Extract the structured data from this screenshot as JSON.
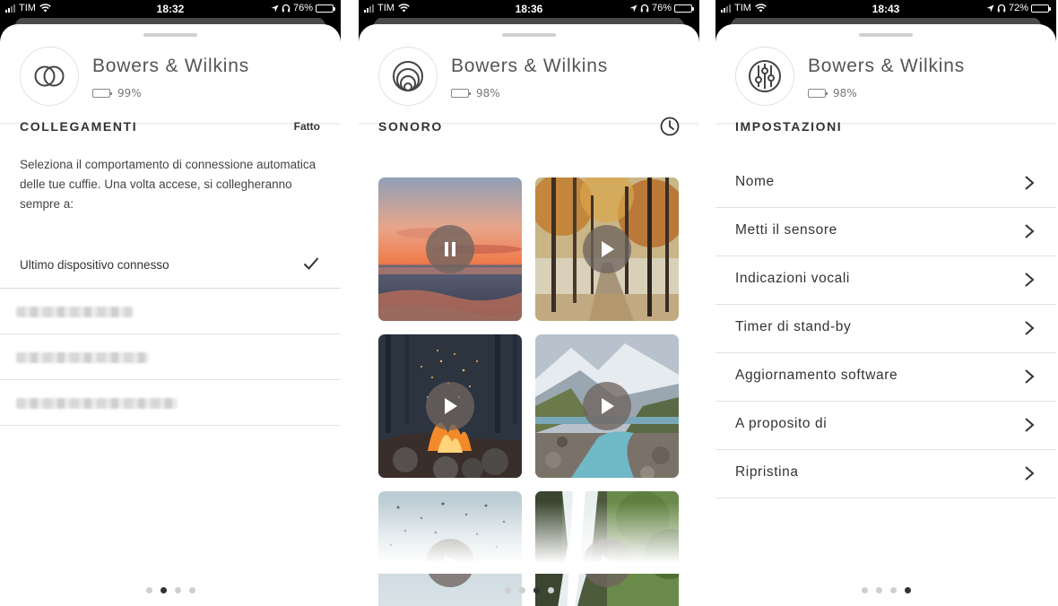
{
  "screens": [
    {
      "status": {
        "carrier": "TIM",
        "time": "18:32",
        "battery": "76%"
      },
      "device": {
        "name": "Bowers & Wilkins",
        "battery": "99%"
      },
      "section": {
        "title": "COLLEGAMENTI",
        "action": "Fatto"
      },
      "description": "Seleziona il comportamento di connessione automatica delle tue cuffie. Una volta accese, si collegheranno sempre a:",
      "options": [
        {
          "label": "Ultimo dispositivo connesso",
          "selected": true
        }
      ],
      "page_indicator": {
        "count": 4,
        "active": 1
      }
    },
    {
      "status": {
        "carrier": "TIM",
        "time": "18:36",
        "battery": "76%"
      },
      "device": {
        "name": "Bowers & Wilkins",
        "battery": "98%"
      },
      "section": {
        "title": "SONORO"
      },
      "sounds": [
        {
          "scene": "sunset-sea",
          "state": "pause"
        },
        {
          "scene": "autumn-forest",
          "state": "play"
        },
        {
          "scene": "campfire",
          "state": "play"
        },
        {
          "scene": "mountain-river",
          "state": "play"
        },
        {
          "scene": "rain-window",
          "state": "play"
        },
        {
          "scene": "waterfall",
          "state": "play"
        }
      ],
      "page_indicator": {
        "count": 4,
        "active": 2
      }
    },
    {
      "status": {
        "carrier": "TIM",
        "time": "18:43",
        "battery": "72%"
      },
      "device": {
        "name": "Bowers & Wilkins",
        "battery": "98%"
      },
      "section": {
        "title": "IMPOSTAZIONI"
      },
      "settings": [
        {
          "label": "Nome"
        },
        {
          "label": "Metti il sensore"
        },
        {
          "label": "Indicazioni vocali"
        },
        {
          "label": "Timer di stand-by"
        },
        {
          "label": "Aggiornamento software"
        },
        {
          "label": "A proposito di"
        },
        {
          "label": "Ripristina"
        }
      ],
      "page_indicator": {
        "count": 4,
        "active": 3
      }
    }
  ]
}
